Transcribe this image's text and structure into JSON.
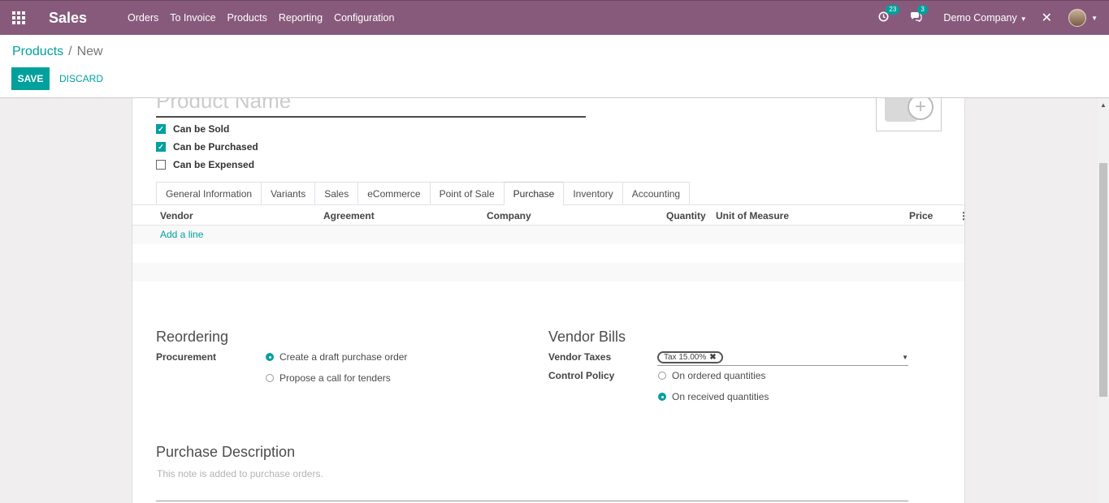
{
  "navbar": {
    "app_title": "Sales",
    "menu": [
      "Orders",
      "To Invoice",
      "Products",
      "Reporting",
      "Configuration"
    ],
    "activity_count": "23",
    "messages_count": "3",
    "company": "Demo Company",
    "brand_color": "#875a7b"
  },
  "control_panel": {
    "breadcrumb_parent": "Products",
    "breadcrumb_separator": "/",
    "breadcrumb_current": "New",
    "save_label": "SAVE",
    "discard_label": "DISCARD",
    "accent_color": "#00a09d"
  },
  "form": {
    "name_placeholder": "Product Name",
    "checkboxes": [
      {
        "label": "Can be Sold",
        "checked": true
      },
      {
        "label": "Can be Purchased",
        "checked": true
      },
      {
        "label": "Can be Expensed",
        "checked": false
      }
    ],
    "tabs": [
      "General Information",
      "Variants",
      "Sales",
      "eCommerce",
      "Point of Sale",
      "Purchase",
      "Inventory",
      "Accounting"
    ],
    "active_tab": "Purchase",
    "vendor_table": {
      "columns": [
        "Vendor",
        "Agreement",
        "Company",
        "Quantity",
        "Unit of Measure",
        "Price"
      ],
      "add_line": "Add a line"
    },
    "reordering": {
      "title": "Reordering",
      "procurement_label": "Procurement",
      "options": [
        {
          "label": "Create a draft purchase order",
          "selected": true
        },
        {
          "label": "Propose a call for tenders",
          "selected": false
        }
      ]
    },
    "vendor_bills": {
      "title": "Vendor Bills",
      "vendor_taxes_label": "Vendor Taxes",
      "tax_tag": "Tax 15.00%",
      "control_policy_label": "Control Policy",
      "options": [
        {
          "label": "On ordered quantities",
          "selected": false
        },
        {
          "label": "On received quantities",
          "selected": true
        }
      ]
    },
    "purchase_description": {
      "title": "Purchase Description",
      "placeholder": "This note is added to purchase orders."
    }
  }
}
